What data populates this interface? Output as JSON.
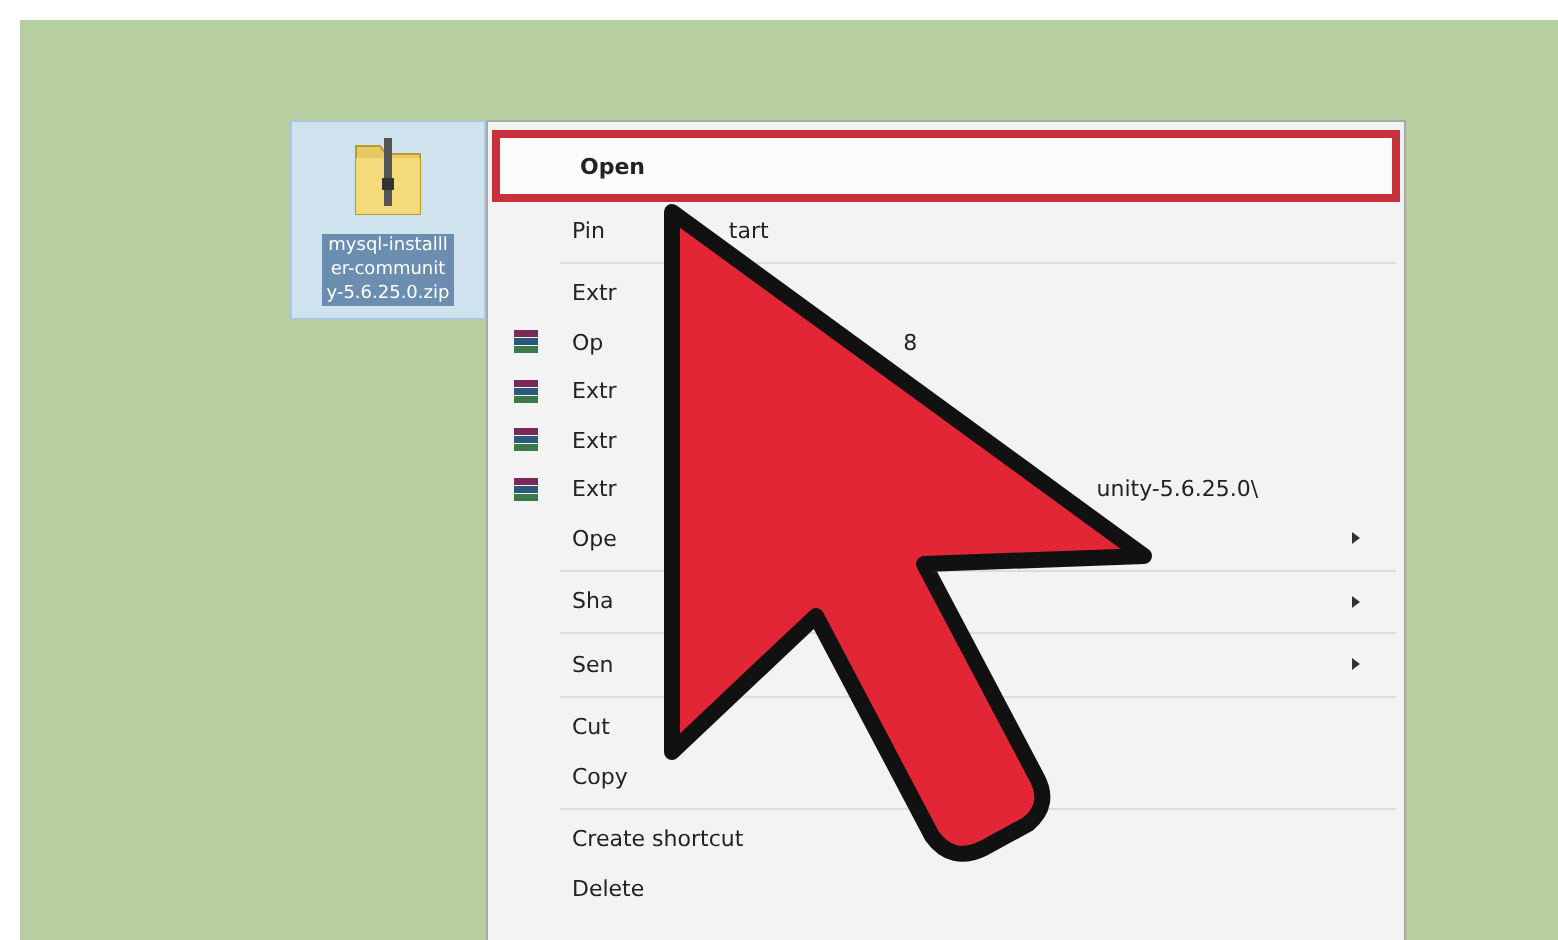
{
  "desktop": {
    "file": {
      "name_lines": [
        "mysql-installl",
        "er-communit",
        "y-5.6.25.0.zip"
      ],
      "selected": true
    }
  },
  "context_menu": {
    "items": [
      {
        "kind": "item",
        "label": "Open",
        "bold": true,
        "selected": true,
        "icon": false,
        "submenu": false
      },
      {
        "kind": "item",
        "label": "Pin",
        "trailing": "tart",
        "bold": false,
        "selected": false,
        "icon": false,
        "submenu": false
      },
      {
        "kind": "separator"
      },
      {
        "kind": "item",
        "label": "Extr",
        "bold": false,
        "selected": false,
        "icon": false,
        "submenu": false
      },
      {
        "kind": "item",
        "label": "Op",
        "trailing": "8",
        "bold": false,
        "selected": false,
        "icon": true,
        "submenu": false
      },
      {
        "kind": "item",
        "label": "Extr",
        "bold": false,
        "selected": false,
        "icon": true,
        "submenu": false
      },
      {
        "kind": "item",
        "label": "Extr",
        "bold": false,
        "selected": false,
        "icon": true,
        "submenu": false
      },
      {
        "kind": "item",
        "label": "Extr",
        "trailing": "unity-5.6.25.0\\",
        "bold": false,
        "selected": false,
        "icon": true,
        "submenu": false
      },
      {
        "kind": "item",
        "label": "Ope",
        "bold": false,
        "selected": false,
        "icon": false,
        "submenu": true
      },
      {
        "kind": "separator"
      },
      {
        "kind": "item",
        "label": "Sha",
        "bold": false,
        "selected": false,
        "icon": false,
        "submenu": true
      },
      {
        "kind": "separator"
      },
      {
        "kind": "item",
        "label": "Sen",
        "bold": false,
        "selected": false,
        "icon": false,
        "submenu": true
      },
      {
        "kind": "separator"
      },
      {
        "kind": "item",
        "label": "Cut",
        "bold": false,
        "selected": false,
        "icon": false,
        "submenu": false
      },
      {
        "kind": "item",
        "label": "Copy",
        "bold": false,
        "selected": false,
        "icon": false,
        "submenu": false
      },
      {
        "kind": "separator"
      },
      {
        "kind": "item",
        "label": "Create shortcut",
        "bold": false,
        "selected": false,
        "icon": false,
        "submenu": false
      },
      {
        "kind": "item",
        "label": "Delete",
        "bold": false,
        "selected": false,
        "icon": false,
        "submenu": false
      }
    ]
  }
}
